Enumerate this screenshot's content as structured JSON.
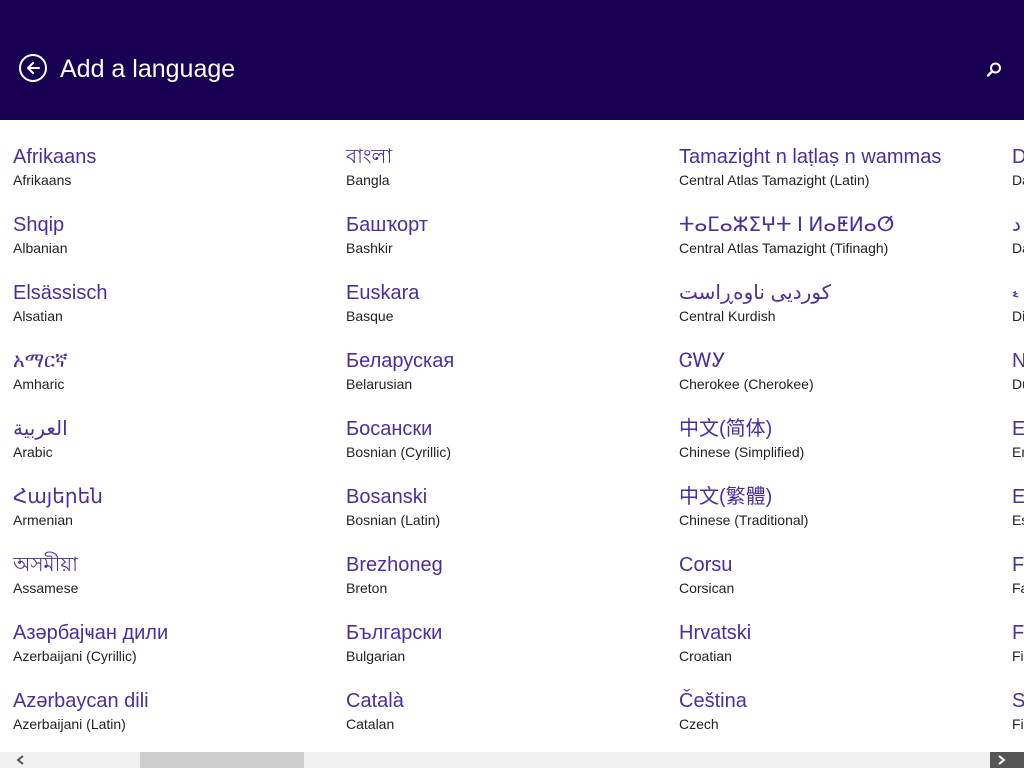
{
  "header": {
    "title": "Add a language",
    "back_icon": "back-arrow-circle-icon",
    "search_icon": "search-icon",
    "background_color": "#180052",
    "accent_color": "#4b2e9e"
  },
  "columns": [
    [
      {
        "native": "Afrikaans",
        "english": "Afrikaans"
      },
      {
        "native": "Shqip",
        "english": "Albanian"
      },
      {
        "native": "Elsässisch",
        "english": "Alsatian"
      },
      {
        "native": "አማርኛ",
        "english": "Amharic"
      },
      {
        "native": "العربية",
        "english": "Arabic"
      },
      {
        "native": "Հայերեն",
        "english": "Armenian"
      },
      {
        "native": "অসমীয়া",
        "english": "Assamese"
      },
      {
        "native": "Азәрбајҹан дили",
        "english": "Azerbaijani (Cyrillic)"
      },
      {
        "native": "Azərbaycan dili",
        "english": "Azerbaijani (Latin)"
      }
    ],
    [
      {
        "native": "বাংলা",
        "english": "Bangla"
      },
      {
        "native": "Башҡорт",
        "english": "Bashkir"
      },
      {
        "native": "Euskara",
        "english": "Basque"
      },
      {
        "native": "Беларуская",
        "english": "Belarusian"
      },
      {
        "native": "Босански",
        "english": "Bosnian (Cyrillic)"
      },
      {
        "native": "Bosanski",
        "english": "Bosnian (Latin)"
      },
      {
        "native": "Brezhoneg",
        "english": "Breton"
      },
      {
        "native": "Български",
        "english": "Bulgarian"
      },
      {
        "native": "Català",
        "english": "Catalan"
      }
    ],
    [
      {
        "native": "Tamazight n laṭlaṣ n wammas",
        "english": "Central Atlas Tamazight (Latin)"
      },
      {
        "native": "ⵜⴰⵎⴰⵣⵉⵖⵜ ⵏ ⵍⴰⵟⵍⴰⵚ",
        "english": "Central Atlas Tamazight (Tifinagh)"
      },
      {
        "native": "کوردیی ناوەڕاست",
        "english": "Central Kurdish"
      },
      {
        "native": "ᏣᎳᎩ",
        "english": "Cherokee (Cherokee)"
      },
      {
        "native": "中文(简体)",
        "english": "Chinese (Simplified)"
      },
      {
        "native": "中文(繁體)",
        "english": "Chinese (Traditional)"
      },
      {
        "native": "Corsu",
        "english": "Corsican"
      },
      {
        "native": "Hrvatski",
        "english": "Croatian"
      },
      {
        "native": "Čeština",
        "english": "Czech"
      }
    ],
    [
      {
        "native": "D",
        "english": "Da"
      },
      {
        "native": "د",
        "english": "Da"
      },
      {
        "native": "ޑ",
        "english": "Di"
      },
      {
        "native": "N",
        "english": "Du"
      },
      {
        "native": "E",
        "english": "En"
      },
      {
        "native": "Ee",
        "english": "Es"
      },
      {
        "native": "Fø",
        "english": "Fa"
      },
      {
        "native": "Fi",
        "english": "Fil"
      },
      {
        "native": "S",
        "english": "Fin"
      }
    ]
  ],
  "scrollbar": {
    "left_icon": "chevron-left-icon",
    "right_icon": "chevron-right-icon"
  }
}
